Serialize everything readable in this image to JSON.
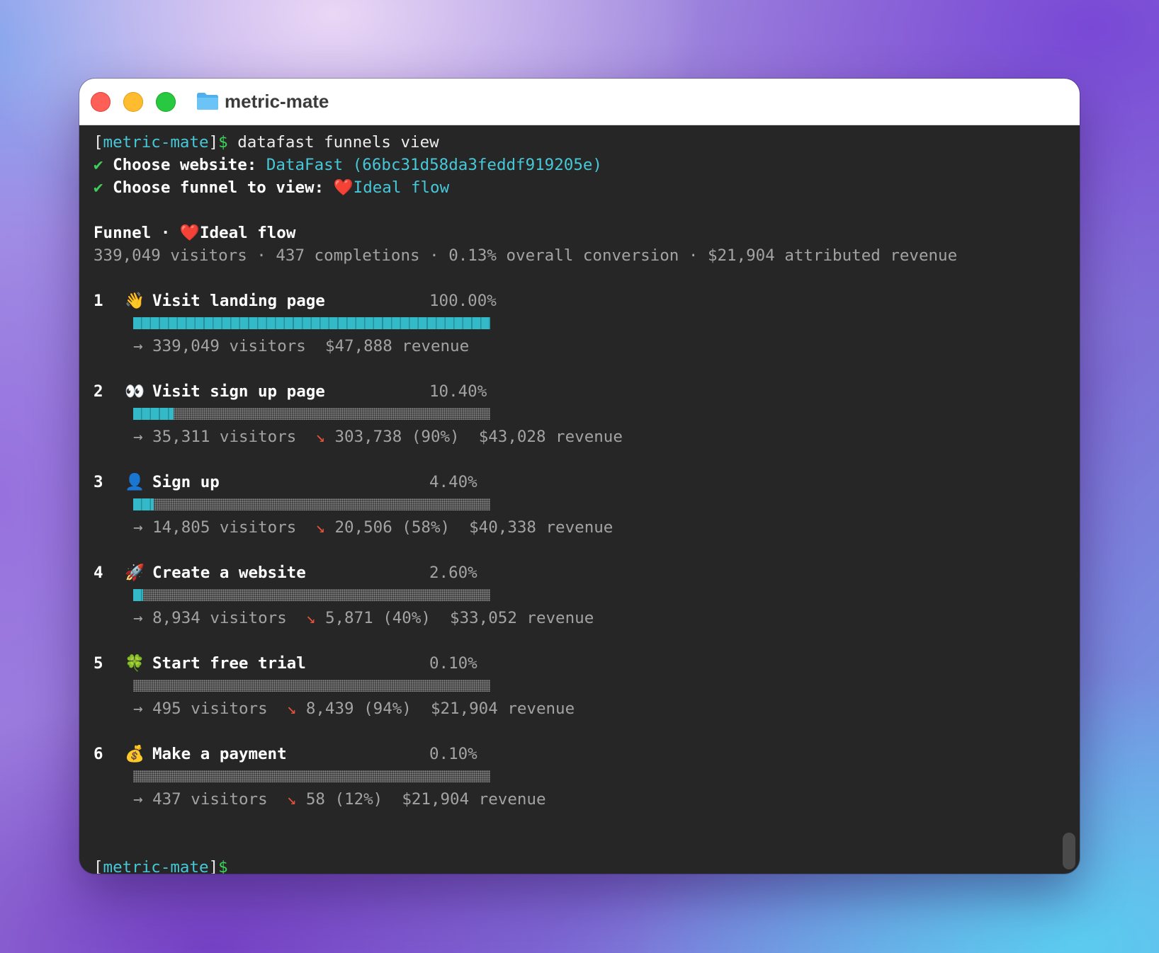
{
  "window": {
    "title": "metric-mate"
  },
  "terminal": {
    "prompt_open": "[",
    "prompt_dir": "metric-mate",
    "prompt_close": "]",
    "prompt_symbol": "$",
    "command": " datafast funnels view",
    "check": "✔",
    "website_label": "Choose website: ",
    "website_value": "DataFast (66bc31d58da3feddf919205e)",
    "funnel_label": "Choose funnel to view: ",
    "funnel_emoji": "❤️",
    "funnel_value": "Ideal flow",
    "heading_prefix": "Funnel · ",
    "heading_emoji": "❤️",
    "heading_name": "Ideal flow",
    "summary": "339,049 visitors · 437 completions · 0.13% overall conversion · $21,904 attributed revenue"
  },
  "steps": [
    {
      "number": "1",
      "emoji": "👋",
      "name": "Visit landing page",
      "percent_label": "100.00%",
      "fill_fraction": 1.0,
      "arrow": "→",
      "visitors": "339,049 visitors",
      "drop_icon": "",
      "dropoff": "",
      "revenue": "$47,888 revenue"
    },
    {
      "number": "2",
      "emoji": "👀",
      "name": "Visit sign up page",
      "percent_label": "10.40%",
      "fill_fraction": 0.114,
      "arrow": "→",
      "visitors": "35,311 visitors",
      "drop_icon": "↘",
      "dropoff": "303,738 (90%)",
      "revenue": "$43,028 revenue"
    },
    {
      "number": "3",
      "emoji": "👤",
      "name": "Sign up",
      "percent_label": "4.40%",
      "fill_fraction": 0.057,
      "arrow": "→",
      "visitors": "14,805 visitors",
      "drop_icon": "↘",
      "dropoff": "20,506 (58%)",
      "revenue": "$40,338 revenue"
    },
    {
      "number": "4",
      "emoji": "🚀",
      "name": "Create a website",
      "percent_label": "2.60%",
      "fill_fraction": 0.028,
      "arrow": "→",
      "visitors": "8,934 visitors",
      "drop_icon": "↘",
      "dropoff": "5,871 (40%)",
      "revenue": "$33,052 revenue"
    },
    {
      "number": "5",
      "emoji": "🍀",
      "name": "Start free trial",
      "percent_label": "0.10%",
      "fill_fraction": 0.0,
      "arrow": "→",
      "visitors": "495 visitors",
      "drop_icon": "↘",
      "dropoff": "8,439 (94%)",
      "revenue": "$21,904 revenue"
    },
    {
      "number": "6",
      "emoji": "💰",
      "name": "Make a payment",
      "percent_label": "0.10%",
      "fill_fraction": 0.0,
      "arrow": "→",
      "visitors": "437 visitors",
      "drop_icon": "↘",
      "dropoff": "58 (12%)",
      "revenue": "$21,904 revenue"
    }
  ],
  "colors": {
    "accent": "#46c8d8",
    "prompt_symbol": "#3ed05a",
    "dropoff": "#e5533d",
    "bar_fill": "#34b9c9"
  }
}
